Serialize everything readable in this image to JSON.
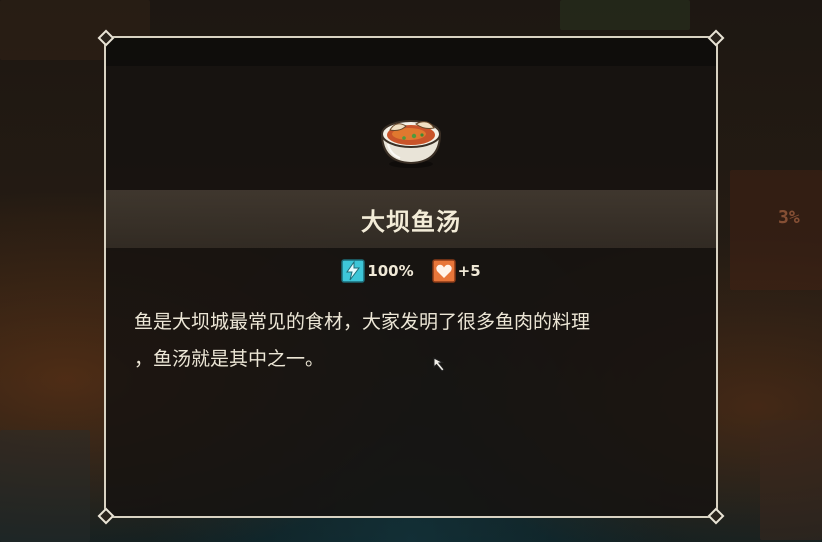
{
  "item": {
    "name": "大坝鱼汤",
    "icon": "fish-soup-bowl-icon"
  },
  "stats": [
    {
      "icon": "energy-icon",
      "value": "100%",
      "color": "#3ec6d8"
    },
    {
      "icon": "heart-icon",
      "value": "+5",
      "color": "#e8763a"
    }
  ],
  "description": "鱼是大坝城最常见的食材，大家发明了很多鱼肉的料理\n，鱼汤就是其中之一。",
  "background": {
    "corner_text": "3%"
  },
  "colors": {
    "frame": "#d8d2c2",
    "title_text": "#f3ecd8",
    "body_text": "#ece6d6"
  }
}
